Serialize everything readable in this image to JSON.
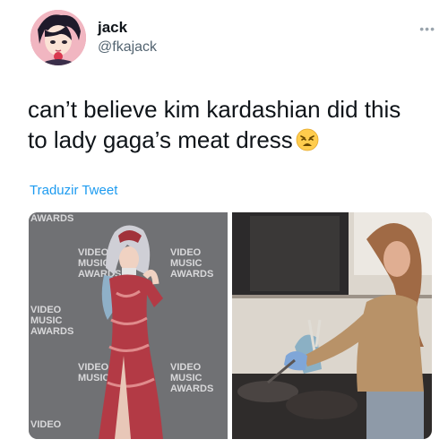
{
  "user": {
    "name": "jack",
    "handle": "@fkajack"
  },
  "menu_icon": "more-dots-icon",
  "tweet": {
    "line1": "can’t believe kim kardashian did this",
    "line2": "to lady gaga’s meat dress",
    "emoji": "weary-face-emoji"
  },
  "translate_label": "Traduzir Tweet",
  "media": {
    "left_backdrop_text": [
      "VIDEO",
      "MUSIC",
      "AWARDS",
      "AWARDS"
    ]
  },
  "colors": {
    "link": "#1d9bf0",
    "text": "#0f1419",
    "secondary": "#536471"
  }
}
